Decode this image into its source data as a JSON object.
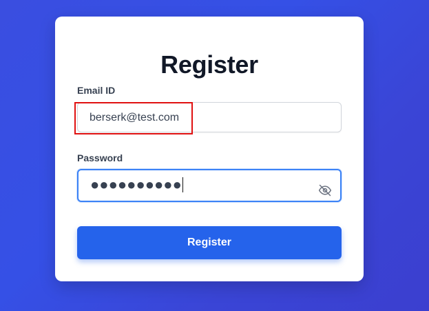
{
  "form": {
    "title": "Register",
    "email": {
      "label": "Email ID",
      "value": "berserk@test.com"
    },
    "password": {
      "label": "Password",
      "masked_value": "●●●●●●●●●●",
      "toggle_icon": "eye-slash-icon"
    },
    "submit_label": "Register"
  },
  "colors": {
    "background": "#3550e6",
    "button": "#2563eb",
    "focus_border": "#3b82f6",
    "highlight": "#e01010"
  }
}
